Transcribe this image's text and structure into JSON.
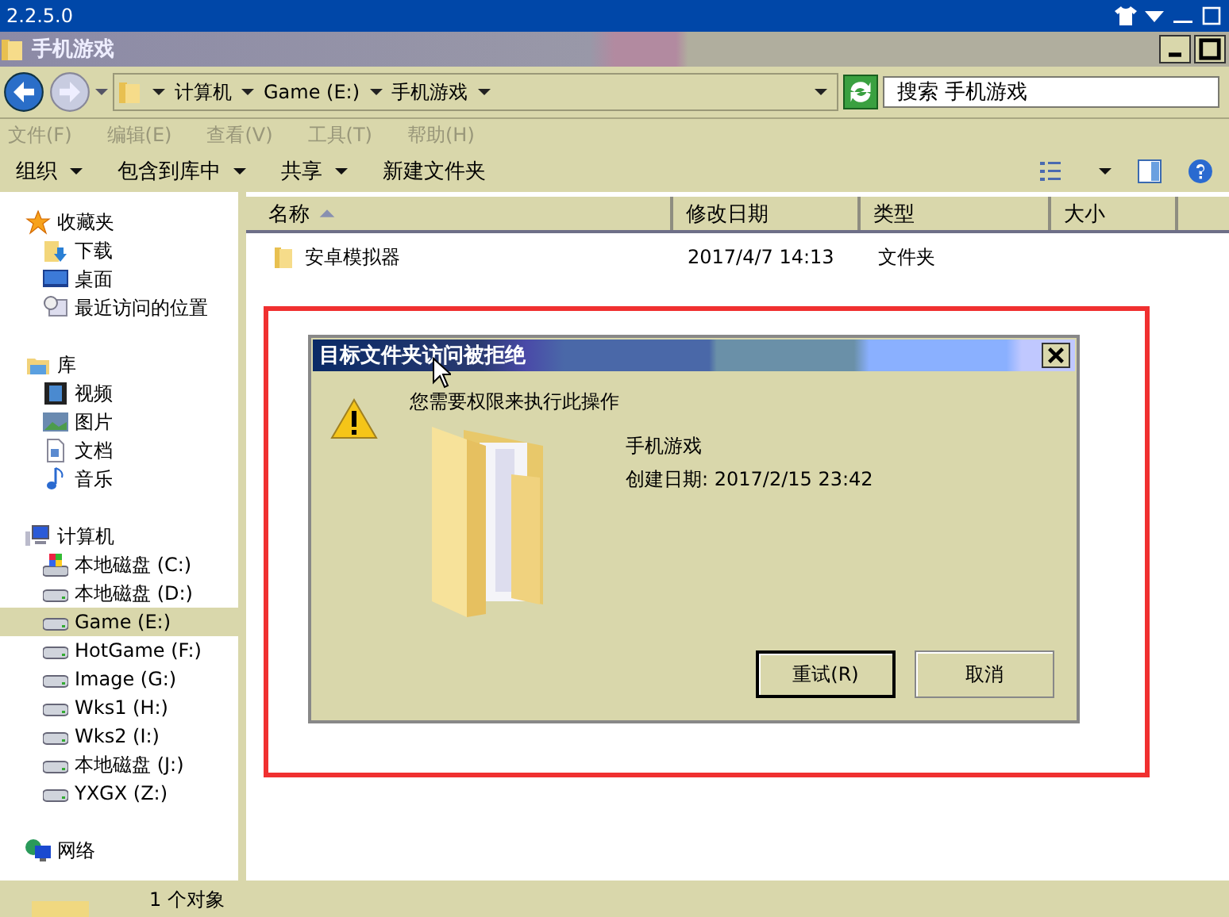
{
  "app_bar": {
    "version": "2.2.5.0"
  },
  "window": {
    "title": "手机游戏"
  },
  "address": {
    "segments": [
      "计算机",
      "Game (E:)",
      "手机游戏"
    ]
  },
  "search": {
    "placeholder": "搜索 手机游戏"
  },
  "menu": [
    {
      "label": "文件(F)",
      "disabled": true
    },
    {
      "label": "编辑(E)",
      "disabled": true
    },
    {
      "label": "查看(V)",
      "disabled": true
    },
    {
      "label": "工具(T)",
      "disabled": true
    },
    {
      "label": "帮助(H)",
      "disabled": true
    }
  ],
  "toolbar": [
    {
      "label": "组织",
      "dropdown": true
    },
    {
      "label": "包含到库中",
      "dropdown": true
    },
    {
      "label": "共享",
      "dropdown": true
    },
    {
      "label": "新建文件夹",
      "dropdown": false
    }
  ],
  "sidebar": [
    {
      "label": "收藏夹",
      "kind": "star",
      "selected": false,
      "children": [
        {
          "label": "下载",
          "kind": "download",
          "selected": false
        },
        {
          "label": "桌面",
          "kind": "desktop",
          "selected": false
        },
        {
          "label": "最近访问的位置",
          "kind": "recent",
          "selected": false
        }
      ]
    },
    {
      "label": "库",
      "kind": "library",
      "selected": false,
      "children": [
        {
          "label": "视频",
          "kind": "video",
          "selected": false
        },
        {
          "label": "图片",
          "kind": "image",
          "selected": false
        },
        {
          "label": "文档",
          "kind": "document",
          "selected": false
        },
        {
          "label": "音乐",
          "kind": "music",
          "selected": false
        }
      ]
    },
    {
      "label": "计算机",
      "kind": "computer",
      "selected": false,
      "children": [
        {
          "label": "本地磁盘 (C:)",
          "kind": "system-drive",
          "selected": false
        },
        {
          "label": "本地磁盘 (D:)",
          "kind": "drive",
          "selected": false
        },
        {
          "label": "Game (E:)",
          "kind": "drive",
          "selected": true
        },
        {
          "label": "HotGame (F:)",
          "kind": "drive",
          "selected": false
        },
        {
          "label": "Image (G:)",
          "kind": "drive",
          "selected": false
        },
        {
          "label": "Wks1 (H:)",
          "kind": "drive",
          "selected": false
        },
        {
          "label": "Wks2 (I:)",
          "kind": "drive",
          "selected": false
        },
        {
          "label": "本地磁盘 (J:)",
          "kind": "drive",
          "selected": false
        },
        {
          "label": "YXGX (Z:)",
          "kind": "drive",
          "selected": false
        }
      ]
    },
    {
      "label": "网络",
      "kind": "network",
      "selected": false
    }
  ],
  "table": {
    "columns": [
      {
        "label": "名称",
        "sorted": true
      },
      {
        "label": "修改日期",
        "sorted": false
      },
      {
        "label": "类型",
        "sorted": false
      },
      {
        "label": "大小",
        "sorted": false
      }
    ],
    "rows": [
      {
        "name": "安卓模拟器",
        "modified": "2017/4/7 14:13",
        "type": "文件夹",
        "selected": false
      }
    ]
  },
  "dialog": {
    "title": "目标文件夹访问被拒绝",
    "message": "您需要权限来执行此操作",
    "item_name": "手机游戏",
    "item_detail": "创建日期: 2017/2/15 23:42",
    "buttons": [
      {
        "label": "重试(R)",
        "default": true
      },
      {
        "label": "取消",
        "default": false
      }
    ]
  },
  "status_bar": {
    "text": "1 个对象"
  }
}
